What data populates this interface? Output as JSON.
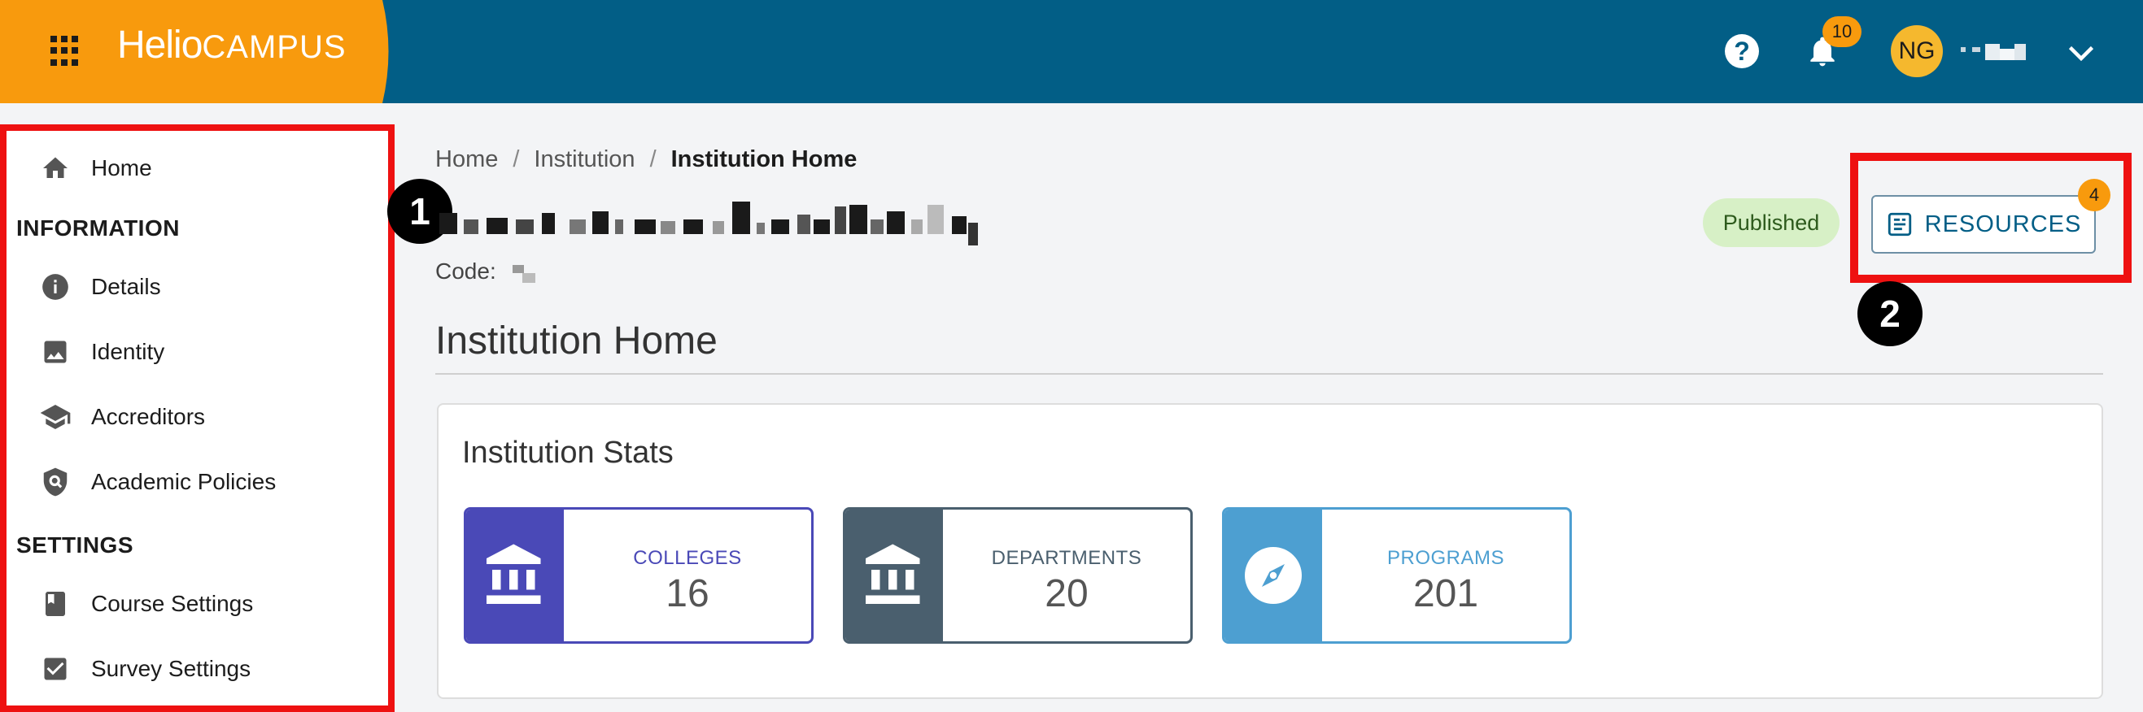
{
  "app": {
    "logo_part1": "Helio",
    "logo_part2": "CAMPUS"
  },
  "topbar": {
    "help_icon": "?",
    "notification_count": "10",
    "avatar_initials": "NG"
  },
  "sidebar": {
    "home_label": "Home",
    "info_heading": "INFORMATION",
    "items_info": [
      {
        "label": "Details",
        "icon": "info-icon"
      },
      {
        "label": "Identity",
        "icon": "image-icon"
      },
      {
        "label": "Accreditors",
        "icon": "graduation-cap-icon"
      },
      {
        "label": "Academic Policies",
        "icon": "policy-shield-icon"
      }
    ],
    "settings_heading": "SETTINGS",
    "items_settings": [
      {
        "label": "Course Settings",
        "icon": "book-icon"
      },
      {
        "label": "Survey Settings",
        "icon": "checkbox-icon"
      }
    ]
  },
  "breadcrumb": {
    "items": [
      "Home",
      "Institution",
      "Institution Home"
    ],
    "separator": "/"
  },
  "header": {
    "code_label": "Code:",
    "status": "Published",
    "resources_label": "RESOURCES",
    "resources_count": "4"
  },
  "annotations": {
    "step1": "1",
    "step2": "2"
  },
  "page": {
    "heading": "Institution Home",
    "stats_title": "Institution Stats",
    "stats": [
      {
        "label": "COLLEGES",
        "value": "16",
        "color": "#4a49b7",
        "icon": "institution-icon"
      },
      {
        "label": "DEPARTMENTS",
        "value": "20",
        "color": "#4a5f6e",
        "icon": "institution-icon"
      },
      {
        "label": "PROGRAMS",
        "value": "201",
        "color": "#4d9fd1",
        "icon": "compass-icon"
      }
    ]
  },
  "colors": {
    "brand_orange": "#f89a0d",
    "topbar_blue": "#025e86",
    "highlight_red": "#ee1111",
    "published_green": "#d7f0c6"
  }
}
